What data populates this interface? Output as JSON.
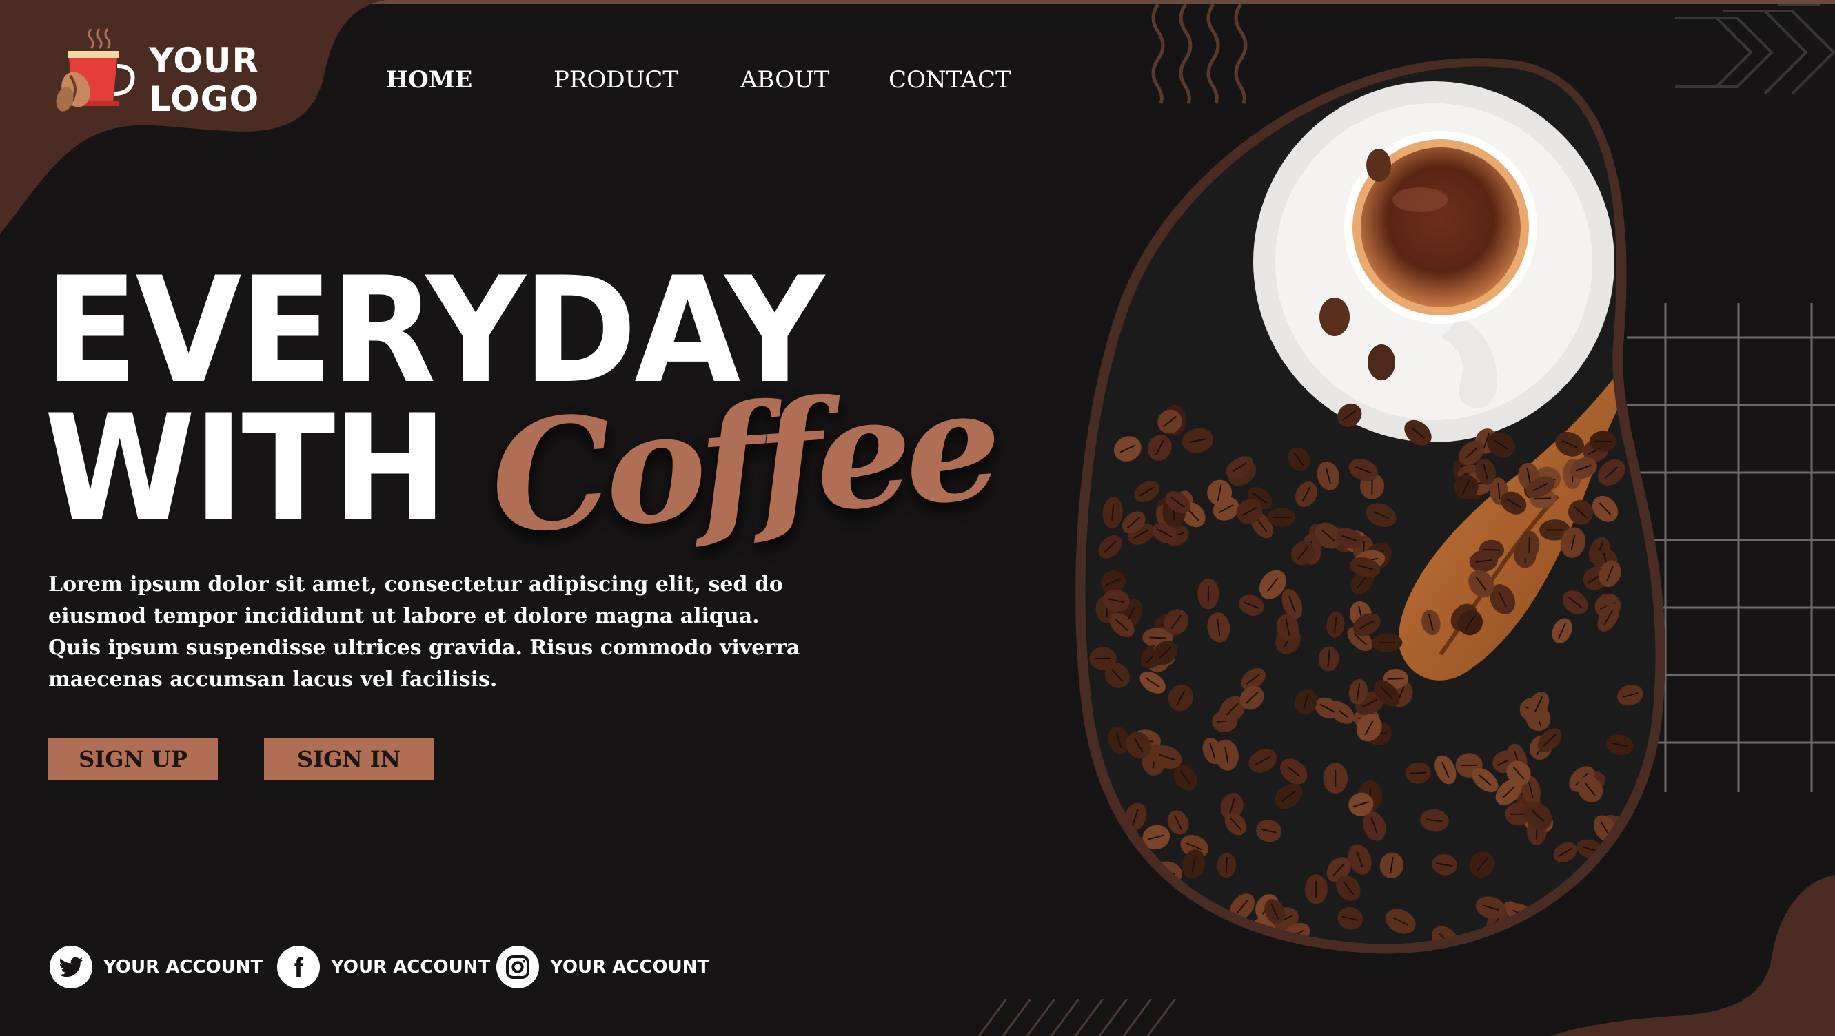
{
  "logo": {
    "line1": "YOUR",
    "line2": "LOGO"
  },
  "nav": {
    "items": [
      {
        "label": "HOME",
        "active": true
      },
      {
        "label": "PRODUCT",
        "active": false
      },
      {
        "label": "ABOUT",
        "active": false
      },
      {
        "label": "CONTACT",
        "active": false
      }
    ]
  },
  "hero": {
    "line1": "EVERYDAY",
    "line2": "WITH",
    "script": "Coffee",
    "description": [
      "Lorem ipsum dolor sit amet, consectetur adipiscing elit, sed do",
      "eiusmod tempor incididunt ut labore et dolore magna aliqua.",
      "Quis ipsum suspendisse ultrices gravida. Risus commodo viverra",
      "maecenas accumsan lacus vel facilisis."
    ]
  },
  "buttons": {
    "signup": "SIGN UP",
    "signin": "SIGN IN"
  },
  "social": [
    {
      "icon": "twitter-icon",
      "label": "YOUR ACCOUNT"
    },
    {
      "icon": "facebook-icon",
      "label": "YOUR ACCOUNT"
    },
    {
      "icon": "instagram-icon",
      "label": "YOUR ACCOUNT"
    }
  ],
  "colors": {
    "background": "#161415",
    "accent": "#b06f55",
    "brown": "#4a2c22",
    "text": "#ffffff"
  }
}
